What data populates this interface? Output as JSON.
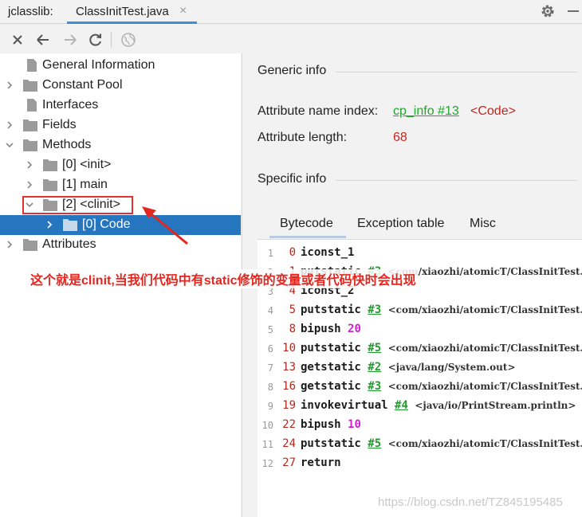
{
  "tabbar": {
    "app_label": "jclasslib:",
    "tab_label": "ClassInitTest.java",
    "close_glyph": "×"
  },
  "toolbar": {
    "icons": [
      "close-icon",
      "back-arrow-icon",
      "forward-arrow-icon",
      "refresh-icon",
      "globe-icon"
    ]
  },
  "tree": {
    "general_information": "General Information",
    "constant_pool": "Constant Pool",
    "interfaces": "Interfaces",
    "fields": "Fields",
    "methods": "Methods",
    "method_init": "[0] <init>",
    "method_main": "[1] main",
    "method_clinit": "[2] <clinit>",
    "code": "[0] Code",
    "attributes": "Attributes"
  },
  "panel": {
    "generic_info": "Generic info",
    "attr_name_index_label": "Attribute name index:",
    "attr_name_index_link": "cp_info #13",
    "attr_name_index_value": "<Code>",
    "attr_length_label": "Attribute length:",
    "attr_length_value": "68",
    "specific_info": "Specific info",
    "tabs": [
      "Bytecode",
      "Exception table",
      "Misc"
    ]
  },
  "bytecode": [
    {
      "line": "1",
      "offset": "0",
      "op": "iconst_1",
      "ref": "",
      "num": "",
      "comment": ""
    },
    {
      "line": "2",
      "offset": "1",
      "op": "putstatic",
      "ref": "#3",
      "num": "",
      "comment": "<com/xiaozhi/atomicT/ClassInitTest."
    },
    {
      "line": "3",
      "offset": "4",
      "op": "iconst_2",
      "ref": "",
      "num": "",
      "comment": ""
    },
    {
      "line": "4",
      "offset": "5",
      "op": "putstatic",
      "ref": "#3",
      "num": "",
      "comment": "<com/xiaozhi/atomicT/ClassInitTest."
    },
    {
      "line": "5",
      "offset": "8",
      "op": "bipush",
      "ref": "",
      "num": "20",
      "comment": ""
    },
    {
      "line": "6",
      "offset": "10",
      "op": "putstatic",
      "ref": "#5",
      "num": "",
      "comment": "<com/xiaozhi/atomicT/ClassInitTest."
    },
    {
      "line": "7",
      "offset": "13",
      "op": "getstatic",
      "ref": "#2",
      "num": "",
      "comment": "<java/lang/System.out>"
    },
    {
      "line": "8",
      "offset": "16",
      "op": "getstatic",
      "ref": "#3",
      "num": "",
      "comment": "<com/xiaozhi/atomicT/ClassInitTest."
    },
    {
      "line": "9",
      "offset": "19",
      "op": "invokevirtual",
      "ref": "#4",
      "num": "",
      "comment": "<java/io/PrintStream.println>"
    },
    {
      "line": "10",
      "offset": "22",
      "op": "bipush",
      "ref": "",
      "num": "10",
      "comment": ""
    },
    {
      "line": "11",
      "offset": "24",
      "op": "putstatic",
      "ref": "#5",
      "num": "",
      "comment": "<com/xiaozhi/atomicT/ClassInitTest."
    },
    {
      "line": "12",
      "offset": "27",
      "op": "return",
      "ref": "",
      "num": "",
      "comment": ""
    }
  ],
  "annotation": "这个就是clinit,当我们代码中有static修饰的变量或者代码快时会出现",
  "watermark": "https://blog.csdn.net/TZ845195485",
  "colors": {
    "accent_blue": "#2675bf",
    "tab_underline": "#3d8ed8",
    "link_green": "#22a52c",
    "value_red": "#c0281e",
    "number_magenta": "#d41fd1",
    "annotation_red": "#e3261f"
  }
}
